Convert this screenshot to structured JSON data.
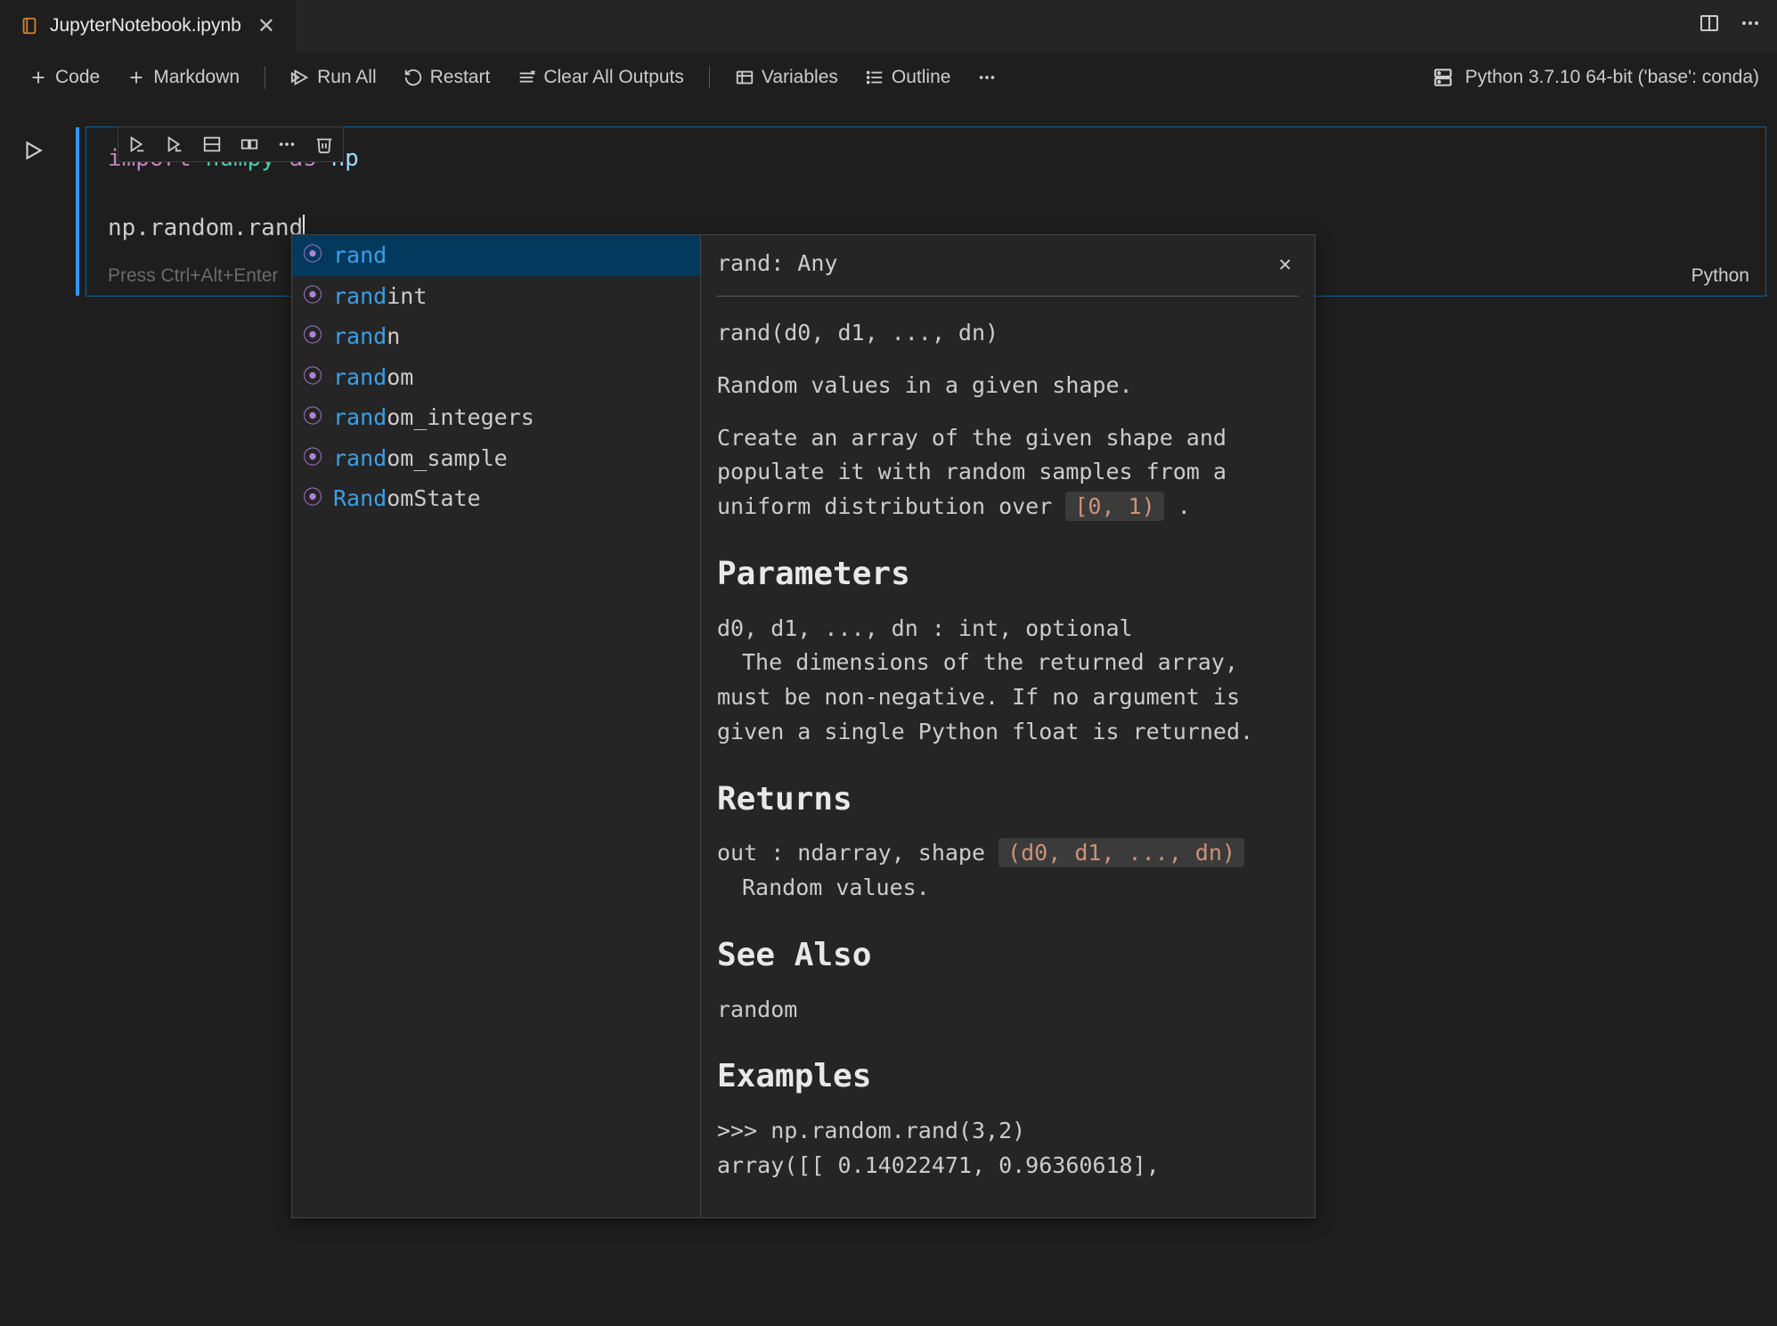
{
  "tab": {
    "title": "JupyterNotebook.ipynb"
  },
  "toolbar": {
    "code": "Code",
    "markdown": "Markdown",
    "run_all": "Run All",
    "restart": "Restart",
    "clear": "Clear All Outputs",
    "variables": "Variables",
    "outline": "Outline"
  },
  "kernel": {
    "name": "Python 3.7.10 64-bit ('base': conda)"
  },
  "cell": {
    "line1_import": "import",
    "line1_module": "numpy",
    "line1_as": "as",
    "line1_alias": "np",
    "line3": "np.random.rand",
    "footer_hint": "Press Ctrl+Alt+Enter",
    "lang": "Python"
  },
  "suggest": {
    "items": [
      {
        "match": "rand",
        "rest": ""
      },
      {
        "match": "rand",
        "rest": "int"
      },
      {
        "match": "rand",
        "rest": "n"
      },
      {
        "match": "rand",
        "rest": "om"
      },
      {
        "match": "rand",
        "rest": "om_integers"
      },
      {
        "match": "rand",
        "rest": "om_sample"
      },
      {
        "match": "Rand",
        "rest": "omState"
      }
    ]
  },
  "doc": {
    "header": "rand: Any",
    "sig": "rand(d0, d1, ..., dn)",
    "summary": "Random values in a given shape.",
    "desc_1": "Create an array of the given shape and populate it with random samples from a uniform distribution over ",
    "desc_code": "[0, 1)",
    "desc_2": " .",
    "h_params": "Parameters",
    "params_sig": "d0, d1, ..., dn : int, optional",
    "params_desc": "The dimensions of the returned array, must be non-negative. If no argument is given a single Python float is returned.",
    "h_returns": "Returns",
    "returns_sig_1": "out : ndarray, shape ",
    "returns_sig_code": "(d0, d1, ..., dn)",
    "returns_desc": "Random values.",
    "h_see": "See Also",
    "see_item": "random",
    "h_examples": "Examples",
    "ex1": ">>> np.random.rand(3,2)",
    "ex2": "array([[ 0.14022471,  0.96360618],"
  }
}
